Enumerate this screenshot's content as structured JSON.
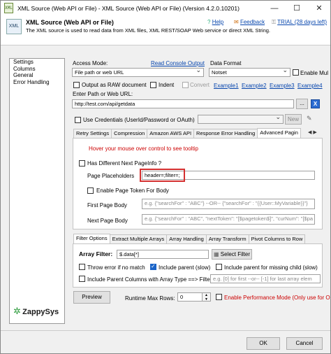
{
  "window": {
    "title": "XML Source (Web API or File) - XML Source (Web API or File) (Version 4.2.0.10201)",
    "icon_text": "XML",
    "minimize": "—",
    "maximize": "☐",
    "close": "✕"
  },
  "header": {
    "title": "XML Source (Web API or File)",
    "description": "The XML source is used to read data from XML files, XML REST/SOAP Web service or direct XML String.",
    "help": "Help",
    "feedback": "Feedback",
    "trial": "TRIAL (28 days left)"
  },
  "tree": {
    "items": [
      "Settings",
      "Columns",
      "General",
      "Error Handling"
    ]
  },
  "access": {
    "label": "Access Mode:",
    "read_console": "Read Console Output",
    "value": "File path or web URL",
    "data_format_label": "Data Format",
    "data_format_value": "Notset",
    "enable_multi": "Enable Mul"
  },
  "options": {
    "raw": "Output as RAW document",
    "indent": "Indent",
    "convert": "Convert",
    "examples": [
      "Example1",
      "Example2",
      "Example3",
      "Example4"
    ]
  },
  "url": {
    "label": "Enter Path or Web URL:",
    "value": "http://test.com/api/getdata",
    "browse": "...",
    "icon": "X"
  },
  "creds": {
    "label": "Use Credentials (UserId/Password or OAuth)",
    "new": "New"
  },
  "tabs1": [
    "Retry Settings",
    "Compression",
    "Amazon AWS API",
    "Response Error Handling",
    "Advanced Pagin"
  ],
  "pagination": {
    "hint": "Hover your mouse over control to see tooltip",
    "has_next": "Has Different Next PageInfo ?",
    "placeholders_label": "Page Placeholders",
    "placeholders_value": "header=;filter=;",
    "enable_token": "Enable Page Token For Body",
    "first_label": "First Page Body",
    "first_ph": "e.g. {\"searchFor\" : \"ABC\"} --OR-- {\"searchFor\" : \"{{User::MyVariable}}\"}",
    "next_label": "Next Page Body",
    "next_ph": "e.g. {\"searchFor\" : \"ABC\", \"nextToken\": \"[$pagetoken$]\", \"curNum\": \"[$pa"
  },
  "tabs2": [
    "Filter Options",
    "Extract Multiple Arrays",
    "Array Handling",
    "Array Transform",
    "Pivot Columns to Row"
  ],
  "filter": {
    "label": "Array Filter:",
    "value": "$.data[*]",
    "select_btn": "Select Filter",
    "throw_error": "Throw error if no match",
    "include_parent": "Include parent (slow)",
    "include_parent_missing": "Include parent for missing child (slow)",
    "include_parent_cols": "Include Parent Columns with Array Type ==> Filter",
    "filter_ph": "e.g. [0] for first --or-- [-1] for last array elem"
  },
  "logo": {
    "text": "ZappySys"
  },
  "footer": {
    "preview": "Preview",
    "max_rows_label": "Runtime Max Rows:",
    "max_rows_value": "0",
    "enable_perf": "Enable Performance Mode (Only use for O",
    "ok": "OK",
    "cancel": "Cancel"
  }
}
